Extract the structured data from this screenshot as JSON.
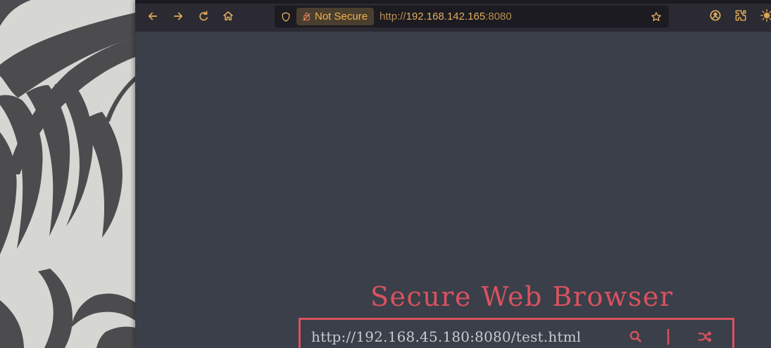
{
  "browser": {
    "security_label": "Not Secure",
    "address_bar": {
      "scheme": "http://",
      "host": "192.168.142.165",
      "port": ":8080"
    },
    "colors": {
      "toolbar_bg": "#2b2a33",
      "url_bg": "#1c1b22",
      "accent": "#e3ad5c",
      "security_chip_bg": "#4a3f2f"
    },
    "icons": {
      "back": "back-arrow-icon",
      "forward": "forward-arrow-icon",
      "reload": "reload-icon",
      "home": "home-icon",
      "tracking_protection": "shield-icon",
      "security": "broken-lock-icon",
      "bookmark": "star-icon",
      "account": "account-icon",
      "extensions": "puzzle-icon",
      "extra": "sun-icon"
    }
  },
  "page": {
    "title": "Secure Web Browser",
    "search": {
      "value": "http://192.168.45.180:8080/test.html",
      "divider_glyph": "|",
      "search_icon": "search-icon",
      "random_icon": "shuffle-icon"
    },
    "colors": {
      "page_bg": "#3a3f49",
      "accent": "#d9525f"
    }
  },
  "desktop": {
    "wallpaper": "wallpaper-leaf-pattern"
  }
}
